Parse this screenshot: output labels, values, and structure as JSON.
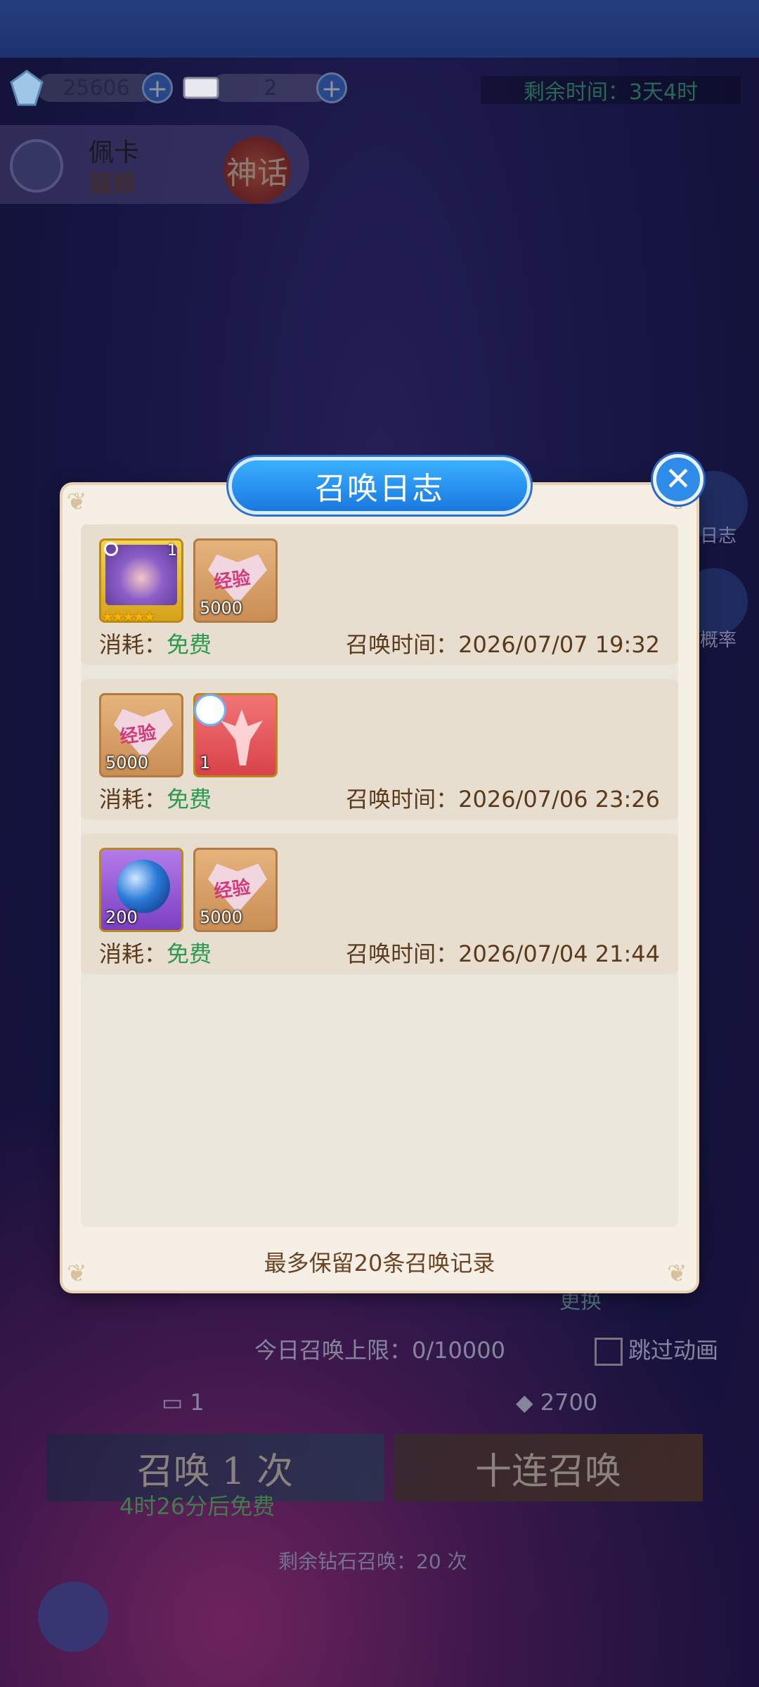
{
  "resources": {
    "gems": "25606",
    "tickets": "2"
  },
  "timer": "剩余时间：3天4时",
  "character": {
    "name": "佩卡",
    "race": "猫娘",
    "rarity": "神话"
  },
  "side_buttons": {
    "log": "日志",
    "rate": "概率"
  },
  "modal": {
    "title": "召唤日志",
    "cost_label": "消耗：",
    "time_label": "召唤时间：",
    "records": [
      {
        "cost": "免费",
        "time": "2026/07/07 19:32",
        "items": [
          {
            "type": "character",
            "count": "1",
            "stars": 5
          },
          {
            "type": "exp",
            "count": "5000",
            "label": "经验"
          }
        ]
      },
      {
        "cost": "免费",
        "time": "2026/07/06 23:26",
        "items": [
          {
            "type": "exp",
            "count": "5000",
            "label": "经验"
          },
          {
            "type": "fairy",
            "count": "1"
          }
        ]
      },
      {
        "cost": "免费",
        "time": "2026/07/04 21:44",
        "items": [
          {
            "type": "orb",
            "count": "200"
          },
          {
            "type": "exp",
            "count": "5000",
            "label": "经验"
          }
        ]
      }
    ],
    "footer": "最多保留20条召唤记录"
  },
  "bottom": {
    "limit": "今日召唤上限：0/10000",
    "skip_anim": "跳过动画",
    "ticket_count": "1",
    "gem_cost": "2700",
    "summon_once": "召唤 1 次",
    "summon_ten": "十连召唤",
    "free_timer": "4时26分后免费",
    "diamond_remaining": "剩余钻石召唤：20 次",
    "change": "更换"
  },
  "colors": {
    "accent": "#2a8be8",
    "free": "#2a9a4e",
    "text_brown": "#5b3a1c"
  }
}
